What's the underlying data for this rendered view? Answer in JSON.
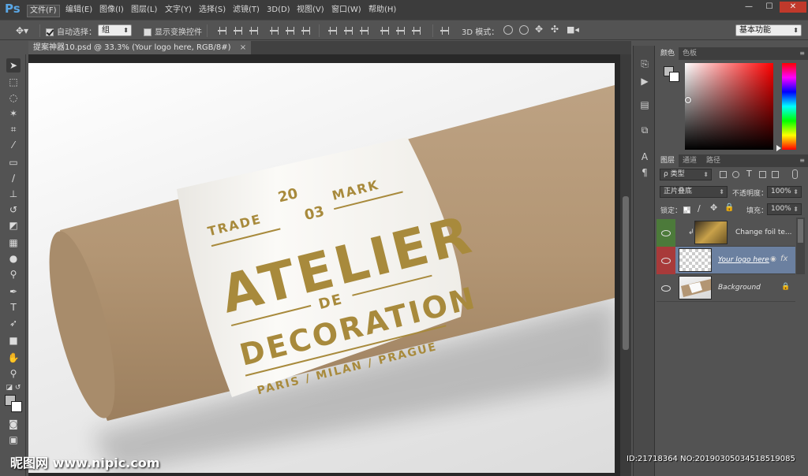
{
  "app": {
    "logo": "Ps",
    "menu": [
      "文件(F)",
      "编辑(E)",
      "图像(I)",
      "图层(L)",
      "文字(Y)",
      "选择(S)",
      "滤镜(T)",
      "3D(D)",
      "视图(V)",
      "窗口(W)",
      "帮助(H)"
    ],
    "window_controls": [
      "—",
      "☐",
      "✕"
    ]
  },
  "options_bar": {
    "auto_select_label": "自动选择：",
    "auto_select_checked": true,
    "auto_select_value": "组",
    "show_transform_label": "显示变换控件",
    "show_transform_checked": false,
    "mode3d_label": "3D 模式：",
    "workspace": "基本功能"
  },
  "document": {
    "tab_title": "提案神器10.psd @ 33.3% (Your logo here, RGB/8#)",
    "tab_close": "×"
  },
  "mockup": {
    "trade": "TRADE",
    "num_top": "20",
    "num_bottom": "03",
    "mark": "MARK",
    "title": "ATELIER",
    "de": "DE",
    "subtitle": "DECORATION",
    "cities": "PARIS / MILAN / PRAGUE",
    "colors": {
      "kraft": "#b59977",
      "label": "#f7f6f2",
      "gold": "#a88a3c"
    }
  },
  "color_panel": {
    "tabs": [
      "颜色",
      "色板"
    ],
    "active_tab": 0
  },
  "layers_panel": {
    "tabs": [
      "图层",
      "通道",
      "路径"
    ],
    "active_tab": 0,
    "filter_label": "ρ 类型",
    "blend_mode": "正片叠底",
    "opacity_label": "不透明度：",
    "opacity": "100%",
    "lock_label": "锁定：",
    "fill_label": "填充：",
    "fill": "100%",
    "layers": [
      {
        "name": "Change foil te...",
        "eye": "visible",
        "eye_color": "#4c7a3a"
      },
      {
        "name": "Your logo here",
        "eye": "visible",
        "eye_color": "#a83a3a",
        "selected": true,
        "fx": "fx"
      },
      {
        "name": "Background",
        "eye": "visible",
        "locked": true
      }
    ]
  },
  "watermark": {
    "left": "昵图网 www.nipic.com",
    "right": "ID:21718364 NO:20190305034518519085"
  }
}
